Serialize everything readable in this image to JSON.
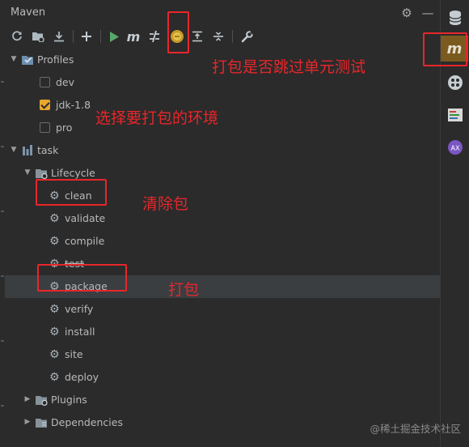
{
  "panel": {
    "title": "Maven"
  },
  "toolbar": {
    "buttons": [
      "reload-icon",
      "generate-sources-icon",
      "download-icon",
      "add-icon",
      "run-icon",
      "execute-goal-icon",
      "toggle-offline-icon",
      "skip-tests-icon",
      "show-dependencies-icon",
      "collapse-all-icon",
      "settings-icon"
    ],
    "execute_label": "m"
  },
  "tree": {
    "profiles": {
      "label": "Profiles",
      "items": [
        {
          "label": "dev",
          "checked": false
        },
        {
          "label": "jdk-1.8",
          "checked": true
        },
        {
          "label": "pro",
          "checked": false
        }
      ]
    },
    "project": {
      "label": "task",
      "lifecycle": {
        "label": "Lifecycle",
        "goals": [
          "clean",
          "validate",
          "compile",
          "test",
          "package",
          "verify",
          "install",
          "site",
          "deploy"
        ]
      },
      "plugins": "Plugins",
      "dependencies": "Dependencies"
    }
  },
  "right_bar": {
    "maven_label": "m"
  },
  "annotations": {
    "skip_tests": "打包是否跳过单元测试",
    "choose_env": "选择要打包的环境",
    "clean": "清除包",
    "package": "打包"
  },
  "watermark": "@稀土掘金技术社区",
  "colors": {
    "background": "#2b2b2b",
    "annotation": "#e8262a",
    "checkbox_checked": "#e7a72c",
    "selected_row": "#3b3e41",
    "run_green": "#59a869"
  }
}
